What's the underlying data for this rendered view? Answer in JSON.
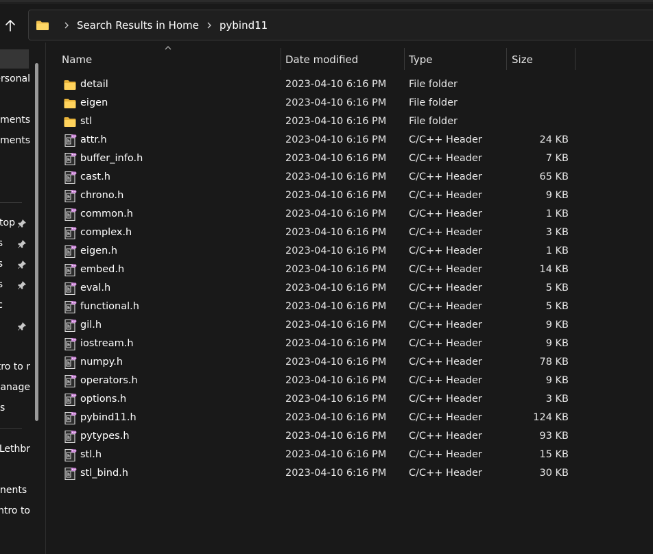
{
  "window": {
    "address": {
      "segments": [
        "Search Results in Home",
        "pybind11"
      ]
    }
  },
  "nav": {
    "items": [
      {
        "label": "Personal",
        "pinned": false
      },
      {
        "label": "Documents",
        "pinned": false
      },
      {
        "label": "Attachments",
        "pinned": false
      },
      {
        "label": "Desktop",
        "pinned": true
      },
      {
        "label": "Downloads",
        "pinned": true
      },
      {
        "label": "Documents",
        "pinned": true
      },
      {
        "label": "Pictures",
        "pinned": true
      },
      {
        "label": "Music",
        "pinned": true
      },
      {
        "label": "Intro to r",
        "pinned": false
      },
      {
        "label": "Manage",
        "pinned": false
      },
      {
        "label": "s",
        "pinned": false
      },
      {
        "label": "Lethbr",
        "pinned": false
      },
      {
        "label": "nents",
        "pinned": false
      },
      {
        "label": "Intro to",
        "pinned": false
      }
    ]
  },
  "columns": {
    "name": "Name",
    "date": "Date modified",
    "type": "Type",
    "size": "Size"
  },
  "files": [
    {
      "name": "detail",
      "date": "2023-04-10 6:16 PM",
      "type": "File folder",
      "size": "",
      "icon": "folder-icon"
    },
    {
      "name": "eigen",
      "date": "2023-04-10 6:16 PM",
      "type": "File folder",
      "size": "",
      "icon": "folder-icon"
    },
    {
      "name": "stl",
      "date": "2023-04-10 6:16 PM",
      "type": "File folder",
      "size": "",
      "icon": "folder-icon"
    },
    {
      "name": "attr.h",
      "date": "2023-04-10 6:16 PM",
      "type": "C/C++ Header",
      "size": "24 KB",
      "icon": "header-file-icon"
    },
    {
      "name": "buffer_info.h",
      "date": "2023-04-10 6:16 PM",
      "type": "C/C++ Header",
      "size": "7 KB",
      "icon": "header-file-icon"
    },
    {
      "name": "cast.h",
      "date": "2023-04-10 6:16 PM",
      "type": "C/C++ Header",
      "size": "65 KB",
      "icon": "header-file-icon"
    },
    {
      "name": "chrono.h",
      "date": "2023-04-10 6:16 PM",
      "type": "C/C++ Header",
      "size": "9 KB",
      "icon": "header-file-icon"
    },
    {
      "name": "common.h",
      "date": "2023-04-10 6:16 PM",
      "type": "C/C++ Header",
      "size": "1 KB",
      "icon": "header-file-icon"
    },
    {
      "name": "complex.h",
      "date": "2023-04-10 6:16 PM",
      "type": "C/C++ Header",
      "size": "3 KB",
      "icon": "header-file-icon"
    },
    {
      "name": "eigen.h",
      "date": "2023-04-10 6:16 PM",
      "type": "C/C++ Header",
      "size": "1 KB",
      "icon": "header-file-icon"
    },
    {
      "name": "embed.h",
      "date": "2023-04-10 6:16 PM",
      "type": "C/C++ Header",
      "size": "14 KB",
      "icon": "header-file-icon"
    },
    {
      "name": "eval.h",
      "date": "2023-04-10 6:16 PM",
      "type": "C/C++ Header",
      "size": "5 KB",
      "icon": "header-file-icon"
    },
    {
      "name": "functional.h",
      "date": "2023-04-10 6:16 PM",
      "type": "C/C++ Header",
      "size": "5 KB",
      "icon": "header-file-icon"
    },
    {
      "name": "gil.h",
      "date": "2023-04-10 6:16 PM",
      "type": "C/C++ Header",
      "size": "9 KB",
      "icon": "header-file-icon"
    },
    {
      "name": "iostream.h",
      "date": "2023-04-10 6:16 PM",
      "type": "C/C++ Header",
      "size": "9 KB",
      "icon": "header-file-icon"
    },
    {
      "name": "numpy.h",
      "date": "2023-04-10 6:16 PM",
      "type": "C/C++ Header",
      "size": "78 KB",
      "icon": "header-file-icon"
    },
    {
      "name": "operators.h",
      "date": "2023-04-10 6:16 PM",
      "type": "C/C++ Header",
      "size": "9 KB",
      "icon": "header-file-icon"
    },
    {
      "name": "options.h",
      "date": "2023-04-10 6:16 PM",
      "type": "C/C++ Header",
      "size": "3 KB",
      "icon": "header-file-icon"
    },
    {
      "name": "pybind11.h",
      "date": "2023-04-10 6:16 PM",
      "type": "C/C++ Header",
      "size": "124 KB",
      "icon": "header-file-icon"
    },
    {
      "name": "pytypes.h",
      "date": "2023-04-10 6:16 PM",
      "type": "C/C++ Header",
      "size": "93 KB",
      "icon": "header-file-icon"
    },
    {
      "name": "stl.h",
      "date": "2023-04-10 6:16 PM",
      "type": "C/C++ Header",
      "size": "15 KB",
      "icon": "header-file-icon"
    },
    {
      "name": "stl_bind.h",
      "date": "2023-04-10 6:16 PM",
      "type": "C/C++ Header",
      "size": "30 KB",
      "icon": "header-file-icon"
    }
  ],
  "colors": {
    "background": "#191919",
    "folder": "#f2c14e",
    "text": "#ffffff"
  }
}
